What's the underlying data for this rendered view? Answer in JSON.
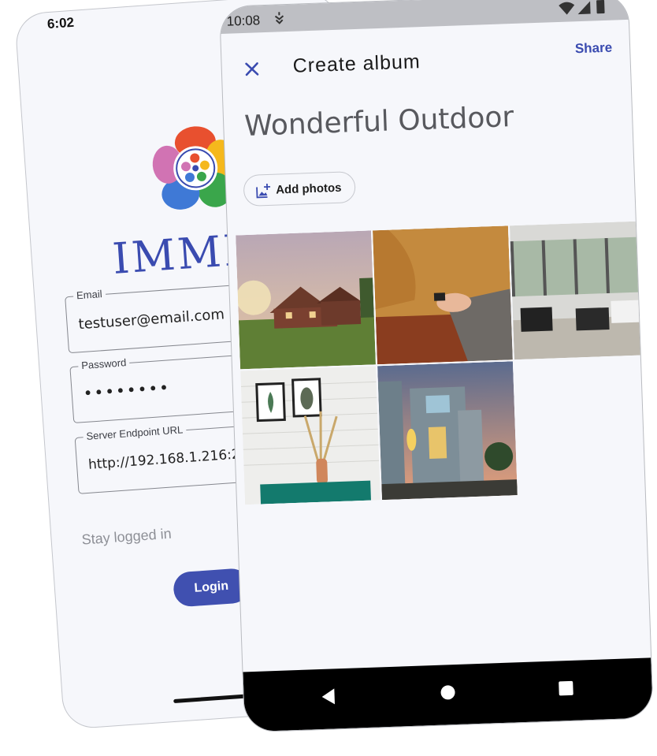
{
  "login_screen": {
    "status_time": "6:02",
    "logo_text": "IMMICH",
    "email": {
      "label": "Email",
      "value": "testuser@email.com"
    },
    "password": {
      "label": "Password",
      "value": "••••••••"
    },
    "server": {
      "label": "Server Endpoint URL",
      "value": "http://192.168.1.216:2283"
    },
    "stay_logged_in": "Stay logged in",
    "login_label": "Login",
    "colors": {
      "primary": "#4050b0"
    }
  },
  "album_screen": {
    "status_time": "10:08",
    "title": "Create album",
    "share_label": "Share",
    "album_name": "Wonderful Outdoor",
    "add_photos_label": "Add photos",
    "photos": [
      {
        "subject": "wooden cabin on lawn at sunset"
      },
      {
        "subject": "person in mustard sweater typing on laptop"
      },
      {
        "subject": "modern living room interior"
      },
      {
        "subject": "white brick wall with framed plant prints and dried grass vase"
      },
      {
        "subject": "modern house exterior at dusk"
      }
    ],
    "icons": {
      "close": "close-icon",
      "add_photo": "add-photo-icon",
      "nav_back": "nav-back-icon",
      "nav_home": "nav-home-icon",
      "nav_recents": "nav-recents-icon"
    },
    "colors": {
      "accent": "#3a4bb0"
    }
  }
}
